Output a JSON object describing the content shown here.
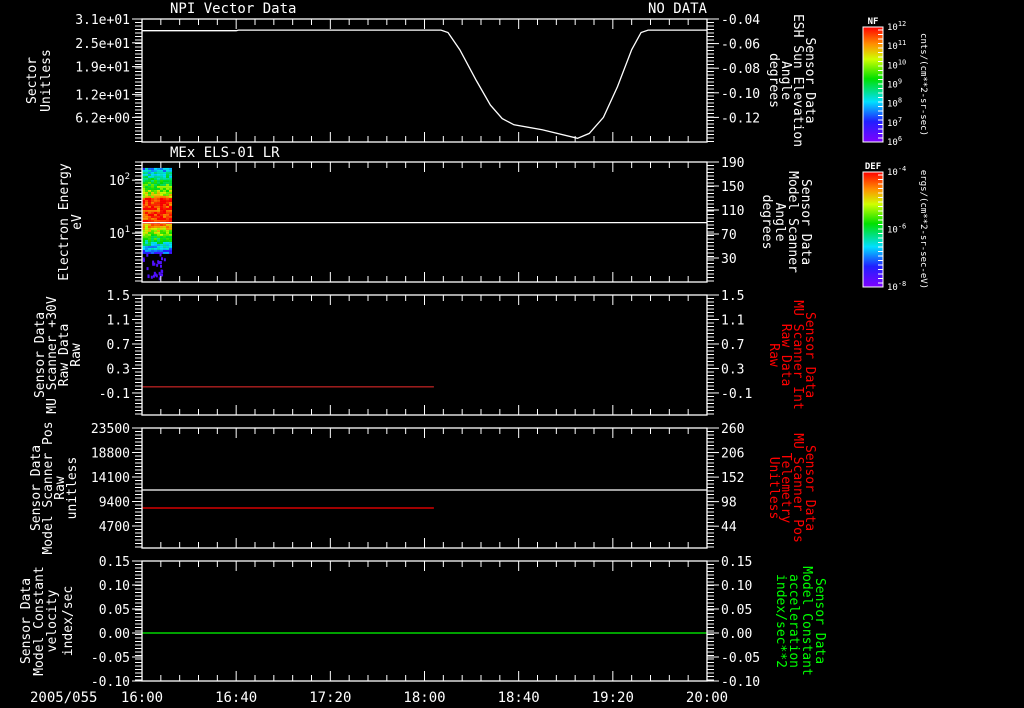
{
  "header": {
    "left_title": "NPI Vector Data",
    "right_status": "NO DATA",
    "panel2_title": "MEx ELS-01 LR"
  },
  "time_axis": {
    "date_label": "2005/055",
    "ticks": [
      "16:00",
      "16:40",
      "17:20",
      "18:00",
      "18:40",
      "19:20",
      "20:00"
    ],
    "start": "16:00",
    "end": "20:00"
  },
  "colorbars": [
    {
      "title": "NF",
      "units": "cnts/(cm**2-sr-sec)",
      "ticks": [
        {
          "base": "10",
          "exp": "12"
        },
        {
          "base": "10",
          "exp": "11"
        },
        {
          "base": "10",
          "exp": "10"
        },
        {
          "base": "10",
          "exp": "9"
        },
        {
          "base": "10",
          "exp": "8"
        },
        {
          "base": "10",
          "exp": "7"
        },
        {
          "base": "10",
          "exp": "6"
        }
      ]
    },
    {
      "title": "DEF",
      "units": "ergs/(cm**2-sr-sec-eV)",
      "ticks": [
        {
          "base": "10",
          "exp": "-4"
        },
        {
          "base": "10",
          "exp": "-6"
        },
        {
          "base": "10",
          "exp": "-8"
        }
      ]
    }
  ],
  "chart_data": [
    {
      "type": "line",
      "left_axis": {
        "label": [
          "Sector",
          "Unitless"
        ],
        "color": "#ffffff",
        "ticks": [
          "3.1e+01",
          "2.5e+01",
          "1.9e+01",
          "1.2e+01",
          "6.2e+00"
        ],
        "tick_values": [
          31,
          25,
          19,
          12,
          6.2
        ],
        "range": [
          0,
          31
        ]
      },
      "right_axis": {
        "label": [
          "Sensor Data",
          "ESH Sun Elevation",
          "Angle",
          "degrees"
        ],
        "color": "#ffffff",
        "ticks": [
          "-0.04",
          "-0.06",
          "-0.08",
          "-0.10",
          "-0.12"
        ],
        "tick_values": [
          -0.04,
          -0.06,
          -0.08,
          -0.1,
          -0.12
        ],
        "range": [
          -0.14,
          -0.04
        ]
      },
      "series": [
        {
          "name": "ESH Sun Elevation Angle",
          "axis": "right",
          "color": "#ffffff",
          "points": [
            [
              "16:00",
              -0.0495
            ],
            [
              "16:40",
              -0.0495
            ],
            [
              "16:41",
              -0.049
            ],
            [
              "18:07",
              -0.049
            ],
            [
              "18:10",
              -0.051
            ],
            [
              "18:15",
              -0.065
            ],
            [
              "18:22",
              -0.09
            ],
            [
              "18:28",
              -0.11
            ],
            [
              "18:33",
              -0.121
            ],
            [
              "18:38",
              -0.126
            ],
            [
              "18:50",
              -0.13
            ],
            [
              "19:05",
              -0.137
            ],
            [
              "19:10",
              -0.133
            ],
            [
              "19:16",
              -0.12
            ],
            [
              "19:22",
              -0.095
            ],
            [
              "19:28",
              -0.065
            ],
            [
              "19:32",
              -0.051
            ],
            [
              "19:35",
              -0.049
            ],
            [
              "20:00",
              -0.049
            ]
          ]
        }
      ]
    },
    {
      "type": "heatmap",
      "left_axis": {
        "label": [
          "Electron Energy",
          "eV"
        ],
        "color": "#ffffff",
        "scale": "log",
        "ticks": [
          {
            "base": "10",
            "exp": "2"
          },
          {
            "base": "10",
            "exp": "1"
          }
        ],
        "tick_values": [
          100,
          10
        ],
        "range": [
          1.2,
          220
        ]
      },
      "right_axis": {
        "label": [
          "Sensor Data",
          "Model Scanner",
          "Angle",
          "degrees"
        ],
        "color": "#ffffff",
        "ticks": [
          "190",
          "150",
          "110",
          "70",
          "30"
        ],
        "tick_values": [
          190,
          150,
          110,
          70,
          30
        ],
        "range": [
          -10,
          190
        ]
      },
      "spectrogram": {
        "t_start": "16:00",
        "t_end": "16:11",
        "energy_range_eV": [
          4.2,
          170
        ],
        "peak_energy_eV": [
          10,
          30
        ],
        "colorbar": "DEF"
      },
      "series": [
        {
          "name": "Model Scanner Angle",
          "axis": "right",
          "color": "#ffffff",
          "points": [
            [
              "16:00",
              89
            ],
            [
              "20:00",
              89
            ]
          ]
        }
      ]
    },
    {
      "type": "line",
      "left_axis": {
        "label": [
          "Sensor Data",
          "MU Scanner +30V",
          "Raw Data",
          "Raw"
        ],
        "color": "#ffffff",
        "ticks": [
          "1.5",
          "1.1",
          "0.7",
          "0.3",
          "-0.1"
        ],
        "tick_values": [
          1.5,
          1.1,
          0.7,
          0.3,
          -0.1
        ],
        "range": [
          -0.46,
          1.5
        ]
      },
      "right_axis": {
        "label": [
          "Sensor Data",
          "MU Scanner Int",
          "Raw Data",
          "Raw"
        ],
        "color": "#ff0000",
        "ticks": [
          "1.5",
          "1.1",
          "0.7",
          "0.3",
          "-0.1"
        ],
        "tick_values": [
          1.5,
          1.1,
          0.7,
          0.3,
          -0.1
        ],
        "range": [
          -0.46,
          1.5
        ]
      },
      "series": [
        {
          "name": "MU Scanner Int",
          "axis": "right",
          "color": "#b02020",
          "points": [
            [
              "16:00",
              0.0
            ],
            [
              "18:04",
              0.0
            ]
          ]
        }
      ]
    },
    {
      "type": "line",
      "left_axis": {
        "label": [
          "Sensor Data",
          "Model Scanner Pos",
          "Raw",
          "unitless"
        ],
        "color": "#ffffff",
        "ticks": [
          "23500",
          "18800",
          "14100",
          "9400",
          "4700"
        ],
        "tick_values": [
          23500,
          18800,
          14100,
          9400,
          4700
        ],
        "range": [
          480,
          23500
        ]
      },
      "right_axis": {
        "label": [
          "Sensor Data",
          "MU Scanner Pos",
          "Telemetry",
          "Unitless"
        ],
        "color": "#ff0000",
        "ticks": [
          "260",
          "206",
          "152",
          "98",
          "44"
        ],
        "tick_values": [
          260,
          206,
          152,
          98,
          44
        ],
        "range": [
          -4,
          260
        ]
      },
      "series": [
        {
          "name": "Model Scanner Pos",
          "axis": "left",
          "color": "#ffffff",
          "points": [
            [
              "16:00",
              11600
            ],
            [
              "20:00",
              11600
            ]
          ]
        },
        {
          "name": "MU Scanner Pos Telemetry",
          "axis": "right",
          "color": "#ff0000",
          "points": [
            [
              "16:00",
              84
            ],
            [
              "18:04",
              84
            ]
          ]
        }
      ]
    },
    {
      "type": "line",
      "left_axis": {
        "label": [
          "Sensor Data",
          "Model Constant",
          "velocity",
          "index/sec"
        ],
        "color": "#ffffff",
        "ticks": [
          "0.15",
          "0.10",
          "0.05",
          "0.00",
          "-0.05",
          "-0.10"
        ],
        "tick_values": [
          0.15,
          0.1,
          0.05,
          0.0,
          -0.05,
          -0.1
        ],
        "range": [
          -0.1,
          0.15
        ]
      },
      "right_axis": {
        "label": [
          "Sensor Data",
          "Model Constant",
          "acceleration",
          "index/sec**2"
        ],
        "color": "#00ff00",
        "ticks": [
          "0.15",
          "0.10",
          "0.05",
          "0.00",
          "-0.05",
          "-0.10"
        ],
        "tick_values": [
          0.15,
          0.1,
          0.05,
          0.0,
          -0.05,
          -0.1
        ],
        "range": [
          -0.1,
          0.15
        ]
      },
      "series": [
        {
          "name": "Model Constant acceleration",
          "axis": "right",
          "color": "#00ff00",
          "points": [
            [
              "16:00",
              0.0
            ],
            [
              "20:00",
              0.0
            ]
          ]
        }
      ]
    }
  ]
}
